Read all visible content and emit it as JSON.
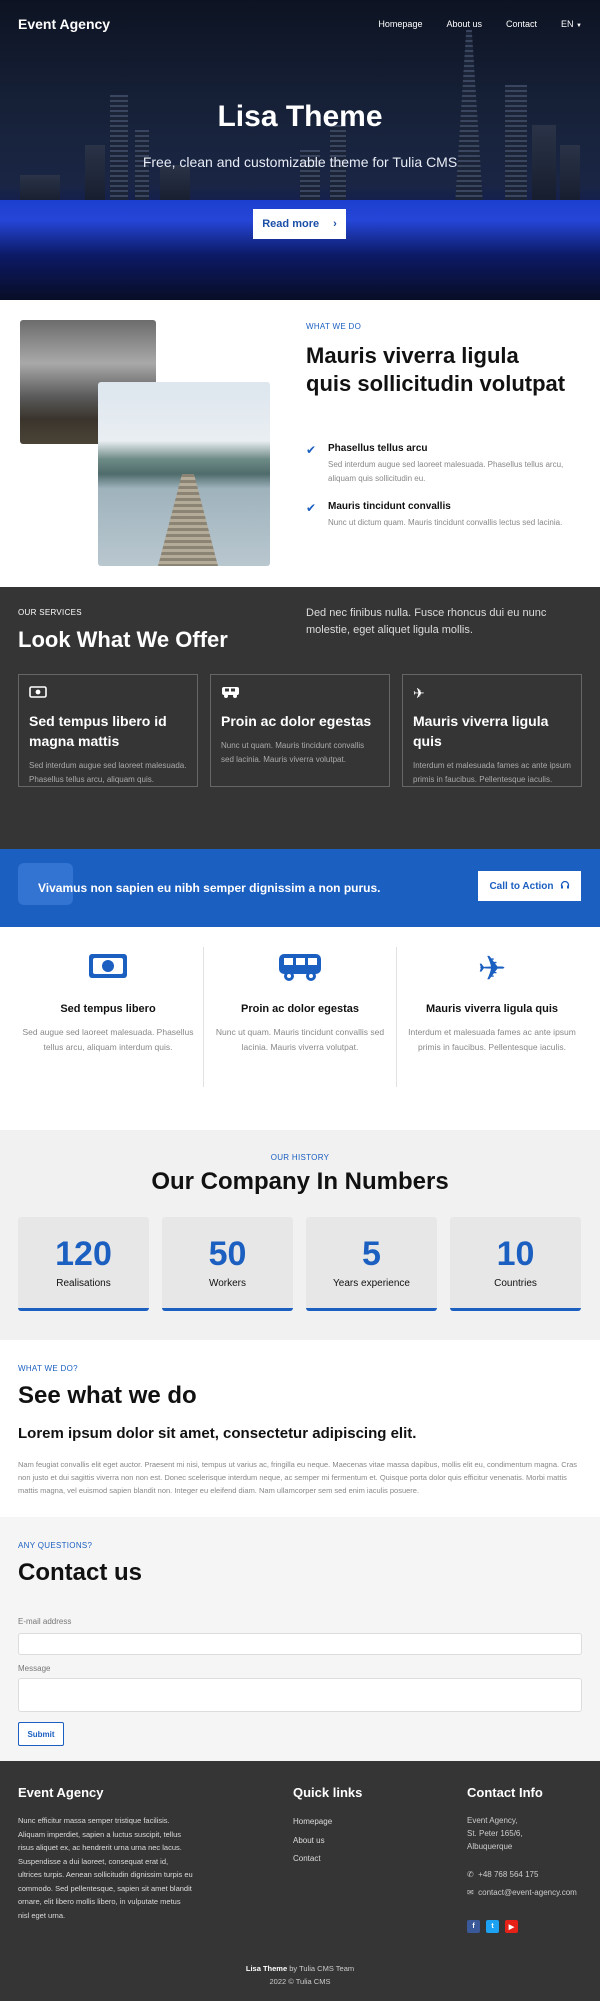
{
  "nav": {
    "brand": "Event Agency",
    "items": [
      "Homepage",
      "About us",
      "Contact"
    ],
    "lang": "EN"
  },
  "hero": {
    "title": "Lisa Theme",
    "subtitle": "Free, clean and customizable theme for Tulia CMS",
    "button": "Read more"
  },
  "what_we_do": {
    "eyebrow": "WHAT WE DO",
    "title": "Mauris viverra ligula quis sollicitudin volutpat",
    "features": [
      {
        "title": "Phasellus tellus arcu",
        "text": "Sed interdum augue sed laoreet malesuada. Phasellus tellus arcu, aliquam quis sollicitudin eu."
      },
      {
        "title": "Mauris tincidunt convallis",
        "text": "Nunc ut dictum quam. Mauris tincidunt convallis lectus sed lacinia."
      }
    ]
  },
  "services": {
    "eyebrow": "OUR SERVICES",
    "title": "Look What We Offer",
    "lead": "Ded nec finibus nulla. Fusce rhoncus dui eu nunc molestie, eget aliquet ligula mollis.",
    "cards": [
      {
        "icon": "money-icon",
        "title": "Sed tempus libero id magna mattis",
        "text": "Sed interdum augue sed laoreet malesuada. Phasellus tellus arcu, aliquam quis."
      },
      {
        "icon": "van-icon",
        "title": "Proin ac dolor egestas",
        "text": "Nunc ut quam. Mauris tincidunt convallis sed lacinia. Mauris viverra volutpat."
      },
      {
        "icon": "plane-icon",
        "title": "Mauris viverra ligula quis",
        "text": "Interdum et malesuada fames ac ante ipsum primis in faucibus. Pellentesque iaculis."
      }
    ]
  },
  "cta": {
    "text": "Vivamus non sapien eu nibh semper dignissim a non purus.",
    "button": "Call to Action"
  },
  "icon_features": [
    {
      "icon": "money-icon",
      "title": "Sed tempus libero",
      "text": "Sed augue sed laoreet malesuada. Phasellus tellus arcu, aliquam interdum quis."
    },
    {
      "icon": "van-icon",
      "title": "Proin ac dolor egestas",
      "text": "Nunc ut quam. Mauris tincidunt convallis sed lacinia. Mauris viverra volutpat."
    },
    {
      "icon": "plane-icon",
      "title": "Mauris viverra ligula quis",
      "text": "Interdum et malesuada fames ac ante ipsum primis in faucibus. Pellentesque iaculis."
    }
  ],
  "numbers": {
    "eyebrow": "OUR HISTORY",
    "title": "Our Company In Numbers",
    "stats": [
      {
        "value": "120",
        "label": "Realisations"
      },
      {
        "value": "50",
        "label": "Workers"
      },
      {
        "value": "5",
        "label": "Years experience"
      },
      {
        "value": "10",
        "label": "Countries"
      }
    ]
  },
  "see": {
    "eyebrow": "WHAT WE DO?",
    "title": "See what we do",
    "subtitle": "Lorem ipsum dolor sit amet, consectetur adipiscing elit.",
    "text": "Nam feugiat convallis elit eget auctor. Praesent mi nisi, tempus ut varius ac, fringilla eu neque. Maecenas vitae massa dapibus, mollis elit eu, condimentum magna. Cras non justo et dui sagittis viverra non non est. Donec scelerisque interdum neque, ac semper mi fermentum et. Quisque porta dolor quis efficitur venenatis. Morbi mattis mattis magna, vel euismod sapien blandit non. Integer eu eleifend diam. Nam ullamcorper sem sed enim iaculis posuere."
  },
  "contact": {
    "eyebrow": "ANY QUESTIONS?",
    "title": "Contact us",
    "email_label": "E-mail address",
    "message_label": "Message",
    "submit": "Submit"
  },
  "footer": {
    "brand": "Event Agency",
    "about": "Nunc efficitur massa semper tristique facilisis. Aliquam imperdiet, sapien a luctus suscipit, tellus risus aliquet ex, ac hendrerit urna urna nec lacus. Suspendisse a dui laoreet, consequat erat id, ultrices turpis. Aenean sollicitudin dignissim turpis eu commodo. Sed pellentesque, sapien sit amet blandit ornare, elit libero mollis libero, in vulputate metus nisl eget urna.",
    "quick_title": "Quick links",
    "quick_links": [
      "Homepage",
      "About us",
      "Contact"
    ],
    "info_title": "Contact Info",
    "address": [
      "Event Agency,",
      "St. Peter 165/6,",
      "Albuquerque"
    ],
    "phone": "+48 768 564 175",
    "email": "contact@event-agency.com",
    "credit_theme": "Lisa Theme",
    "credit_by": " by Tulia CMS Team",
    "copyright": "2022 © Tulia CMS"
  }
}
